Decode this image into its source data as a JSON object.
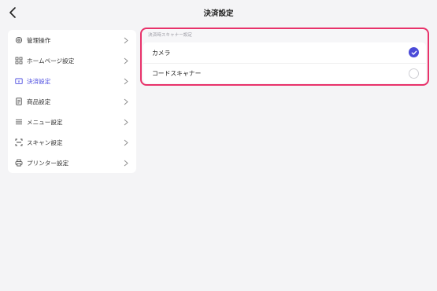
{
  "header": {
    "title": "決済設定",
    "back_icon": "chevron-left-icon"
  },
  "sidebar": {
    "items": [
      {
        "label": "管理操作",
        "icon": "gear-icon",
        "active": false
      },
      {
        "label": "ホームページ設定",
        "icon": "grid-icon",
        "active": false
      },
      {
        "label": "決済設定",
        "icon": "payment-icon",
        "active": true
      },
      {
        "label": "商品設定",
        "icon": "document-icon",
        "active": false
      },
      {
        "label": "メニュー設定",
        "icon": "menu-icon",
        "active": false
      },
      {
        "label": "スキャン設定",
        "icon": "scan-icon",
        "active": false
      },
      {
        "label": "プリンター設定",
        "icon": "printer-icon",
        "active": false
      }
    ]
  },
  "scanner_settings": {
    "section_label": "決済時スキャナー設定",
    "options": [
      {
        "label": "カメラ",
        "selected": true
      },
      {
        "label": "コードスキャナー",
        "selected": false
      }
    ]
  },
  "colors": {
    "accent": "#4b4bd8",
    "highlight_border": "#e8326a",
    "background": "#f4f4f6"
  }
}
